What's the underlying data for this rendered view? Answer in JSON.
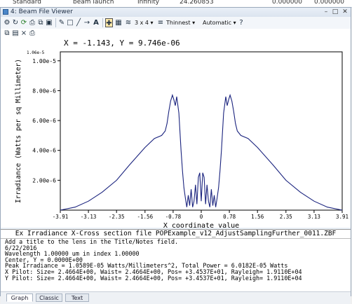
{
  "background_row": {
    "col1": "Standard",
    "col2": "beam launch",
    "col3": "Infinity",
    "col4": "24.260853",
    "col5": "0.000000",
    "col6": "0.000000"
  },
  "window": {
    "title": "4: Beam File Viewer",
    "minimize": "–",
    "maximize": "□",
    "close": "✕"
  },
  "toolbar": {
    "grid_label": "3 x 4",
    "line_label": "Thinnest",
    "scale_label": "Automatic",
    "text_tool": "A"
  },
  "coordinates_readout": "X = -1.143, Y = 9.746e-06",
  "chart_data": {
    "type": "line",
    "xlabel": "X coordinate value",
    "ylabel": "Irradiance (Watts per sq Millimeter)",
    "xlim": [
      -3.91,
      3.91
    ],
    "ylim": [
      0,
      1.06e-05
    ],
    "y_top_label": "1.06e-5",
    "x_ticks": [
      "-3.91",
      "-3.13",
      "-2.35",
      "-1.56",
      "-0.78",
      "0",
      "0.78",
      "1.56",
      "2.35",
      "3.13",
      "3.91"
    ],
    "x_tick_values": [
      -3.91,
      -3.13,
      -2.35,
      -1.56,
      -0.78,
      0,
      0.78,
      1.56,
      2.35,
      3.13,
      3.91
    ],
    "y_ticks": [
      "2.00e-6",
      "4.00e-6",
      "6.00e-6",
      "8.00e-6",
      "1.00e-5"
    ],
    "y_tick_values": [
      2e-06,
      4e-06,
      6e-06,
      8e-06,
      1e-05
    ],
    "grid": false,
    "series_color": "#1a237e",
    "series": [
      {
        "x": [
          -3.91,
          -3.5,
          -3.13,
          -2.75,
          -2.35,
          -2.0,
          -1.56,
          -1.3,
          -1.1,
          -1.0,
          -0.95,
          -0.9,
          -0.85,
          -0.8,
          -0.76,
          -0.72,
          -0.68,
          -0.62,
          -0.56,
          -0.52,
          -0.48,
          -0.44,
          -0.4,
          -0.36,
          -0.32,
          -0.28,
          -0.24,
          -0.2,
          -0.16,
          -0.12,
          -0.08,
          -0.04,
          0.0,
          0.04,
          0.08,
          0.12,
          0.16,
          0.2,
          0.24,
          0.28,
          0.32,
          0.36,
          0.4,
          0.44,
          0.48,
          0.52,
          0.56,
          0.62,
          0.68,
          0.72,
          0.76,
          0.8,
          0.85,
          0.9,
          0.95,
          1.0,
          1.1,
          1.3,
          1.56,
          2.0,
          2.35,
          2.75,
          3.13,
          3.5,
          3.91
        ],
        "y": [
          0.0,
          2e-07,
          6e-07,
          1.2e-06,
          2e-06,
          3e-06,
          4.2e-06,
          4.8e-06,
          5e-06,
          5.3e-06,
          5.8e-06,
          6.6e-06,
          7.3e-06,
          7.7e-06,
          7.4e-06,
          7e-06,
          7.6e-06,
          6.5e-06,
          4e-06,
          2.6e-06,
          1.5e-06,
          8e-07,
          2e-07,
          1e-06,
          3e-07,
          1.4e-06,
          2e-07,
          6e-07,
          1.7e-06,
          4e-07,
          2.2e-06,
          2.5e-06,
          6e-07,
          2.5e-06,
          2.2e-06,
          4e-07,
          1.7e-06,
          6e-07,
          2e-07,
          1.4e-06,
          3e-07,
          1e-06,
          2e-07,
          8e-07,
          1.5e-06,
          2.6e-06,
          4e-06,
          6.5e-06,
          7.6e-06,
          7e-06,
          7.4e-06,
          7.7e-06,
          7.3e-06,
          6.6e-06,
          5.8e-06,
          5.3e-06,
          5e-06,
          4.8e-06,
          4.2e-06,
          3e-06,
          2e-06,
          1.2e-06,
          6e-07,
          2e-07,
          0.0
        ]
      }
    ]
  },
  "file_label": "Ex Irradiance X-Cross section file POPExample_v12_AdjustSamplingFurther_0011.ZBF",
  "info_lines": [
    "Add a title to the lens in the Title/Notes field.",
    "6/22/2016",
    "Wavelength 1.00000 um in index 1.00000",
    "Center, Y = 0.0000E+00",
    "Peak Irradiance = 1.0589E-05 Watts/Millimeters^2, Total Power = 6.0182E-05 Watts",
    "X Pilot: Size= 2.4664E+00, Waist= 2.4664E+00, Pos= +3.4537E+01, Rayleigh= 1.9110E+04",
    "Y Pilot: Size= 2.4664E+00, Waist= 2.4664E+00, Pos= +3.4537E+01, Rayleigh= 1.9110E+04"
  ],
  "tabs": [
    "Graph",
    "Classic",
    "Text"
  ]
}
